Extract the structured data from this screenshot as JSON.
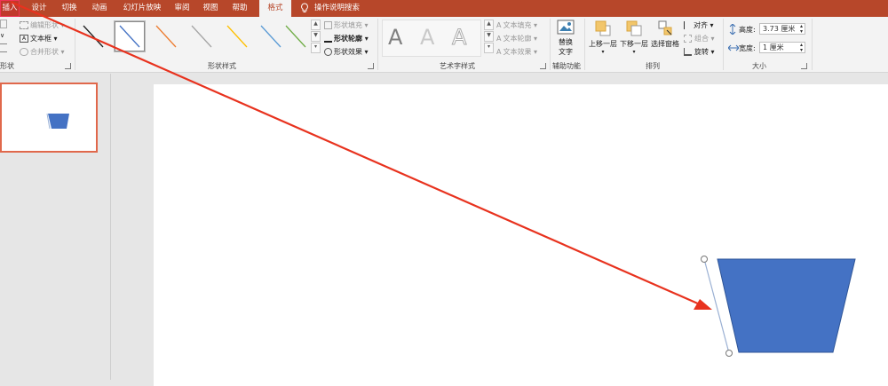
{
  "tabs": [
    {
      "label": "插入",
      "state": "highlight"
    },
    {
      "label": "设计"
    },
    {
      "label": "切换"
    },
    {
      "label": "动画"
    },
    {
      "label": "幻灯片放映"
    },
    {
      "label": "审阅"
    },
    {
      "label": "视图"
    },
    {
      "label": "帮助"
    },
    {
      "label": "格式",
      "state": "active"
    }
  ],
  "search": {
    "icon": "lightbulb-icon",
    "label": "操作说明搜索"
  },
  "insert_shapes": {
    "edit_shape": "编辑形状",
    "text_box": "文本框",
    "merge_shapes": "合并形状",
    "group_label": "形状"
  },
  "shape_styles": {
    "group_label": "形状样式",
    "fill": "形状填充",
    "outline": "形状轮廓",
    "effects": "形状效果",
    "thumb_colors": [
      "#1f1f1f",
      "#4472c4",
      "#ed7d31",
      "#a5a5a5",
      "#ffc000",
      "#5b9bd5",
      "#70ad47"
    ]
  },
  "wordart": {
    "group_label": "艺术字样式",
    "text_fill": "文本填充",
    "text_outline": "文本轮廓",
    "text_effects": "文本效果",
    "sample": "A"
  },
  "accessibility": {
    "alt_text_line1": "替换",
    "alt_text_line2": "文字",
    "group_label": "辅助功能"
  },
  "arrange": {
    "bring_forward": "上移一层",
    "send_backward": "下移一层",
    "selection_pane": "选择窗格",
    "align": "对齐",
    "group": "组合",
    "rotate": "旋转",
    "group_label": "排列"
  },
  "size": {
    "height_label": "高度:",
    "height_value": "3.73 厘米",
    "width_label": "宽度:",
    "width_value": "1 厘米",
    "group_label": "大小"
  },
  "colors": {
    "accent": "#b7472a",
    "shape_fill": "#4472c4",
    "arrow": "#e8321e"
  }
}
